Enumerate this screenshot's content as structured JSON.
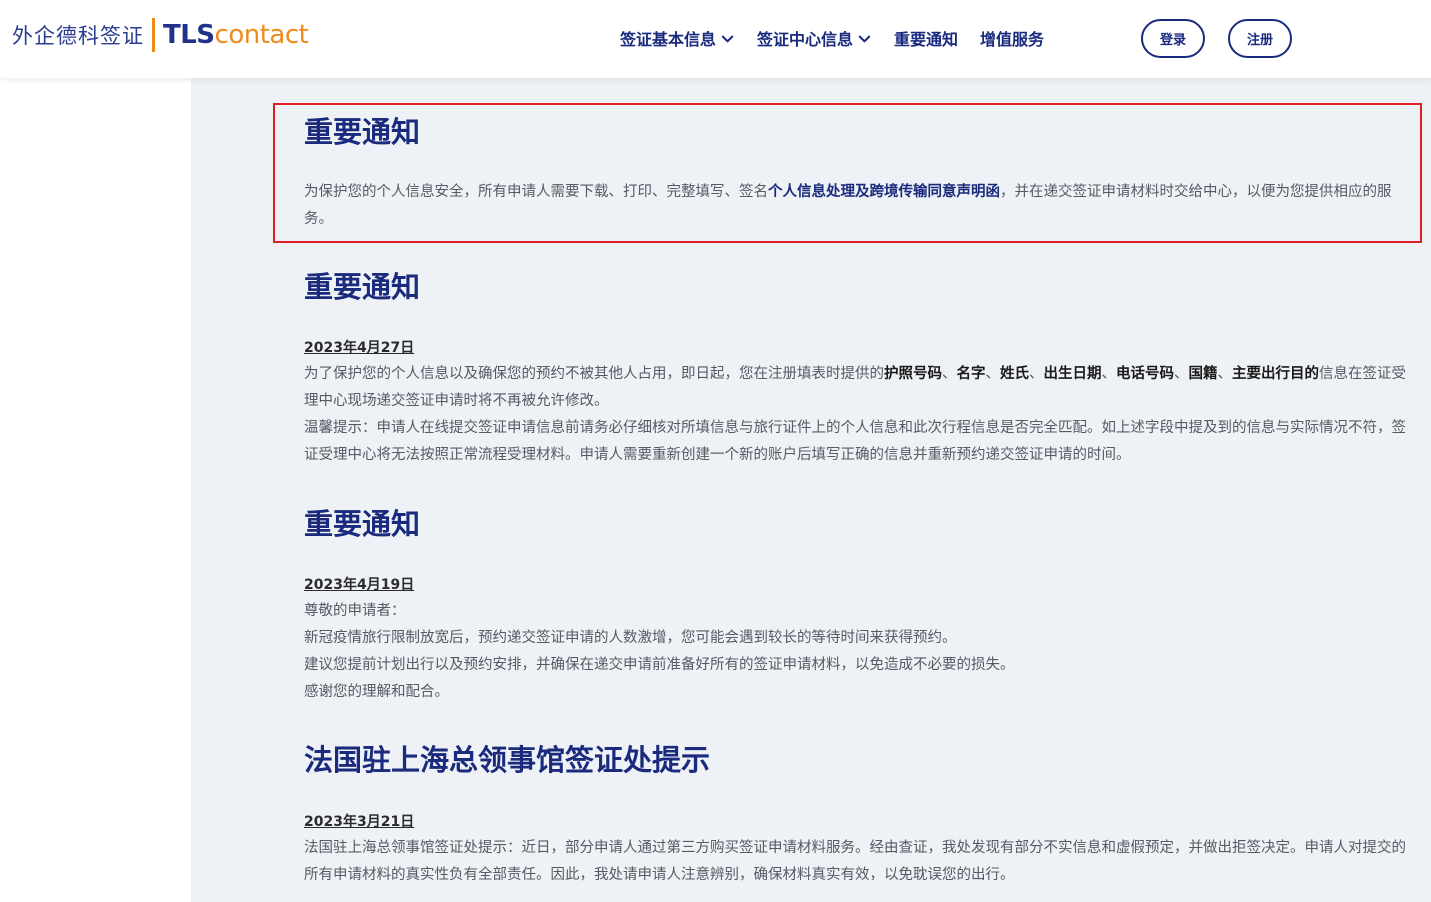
{
  "header": {
    "logo_cn": "外企德科签证",
    "logo_tls": "TLS",
    "logo_contact": "contact",
    "nav": [
      {
        "label": "签证基本信息",
        "has_dropdown": true
      },
      {
        "label": "签证中心信息",
        "has_dropdown": true
      },
      {
        "label": "重要通知",
        "has_dropdown": false
      },
      {
        "label": "增值服务",
        "has_dropdown": false
      }
    ],
    "login_label": "登录",
    "register_label": "注册"
  },
  "notices": [
    {
      "title": "重要通知",
      "p1_a": "为保护您的个人信息安全，所有申请人需要下载、打印、完整填写、签名",
      "p1_link": "个人信息处理及跨境传输同意声明函",
      "p1_b": "，并在递交签证申请材料时交给中心，以便为您提供相应的服务。"
    },
    {
      "title": "重要通知",
      "date": "2023年4月27日",
      "p1_a": "为了保护您的个人信息以及确保您的预约不被其他人占用，即日起，您在注册填表时提供的",
      "f1": "护照号码",
      "sep1": "、",
      "f2": "名字",
      "sep2": "、",
      "f3": "姓氏",
      "sep3": "、",
      "f4": "出生日期",
      "sep4": "、",
      "f5": "电话号码",
      "sep5": "、",
      "f6": "国籍",
      "sep6": "、",
      "f7": "主要出行目的",
      "p1_b": "信息在签证受理中心现场递交签证申请时将不再被允许修改。",
      "p2": "温馨提示：申请人在线提交签证申请信息前请务必仔细核对所填信息与旅行证件上的个人信息和此次行程信息是否完全匹配。如上述字段中提及到的信息与实际情况不符，签证受理中心将无法按照正常流程受理材料。申请人需要重新创建一个新的账户后填写正确的信息并重新预约递交签证申请的时间。"
    },
    {
      "title": "重要通知",
      "date": "2023年4月19日",
      "l1": "尊敬的申请者：",
      "l2": "新冠疫情旅行限制放宽后，预约递交签证申请的人数激增，您可能会遇到较长的等待时间来获得预约。",
      "l3": "建议您提前计划出行以及预约安排，并确保在递交申请前准备好所有的签证申请材料，以免造成不必要的损失。",
      "l4": "感谢您的理解和配合。"
    },
    {
      "title": "法国驻上海总领事馆签证处提示",
      "date": "2023年3月21日",
      "p1": "法国驻上海总领事馆签证处提示：近日，部分申请人通过第三方购买签证申请材料服务。经由查证，我处发现有部分不实信息和虚假预定，并做出拒签决定。申请人对提交的所有申请材料的真实性负有全部责任。因此，我处请申请人注意辨别，确保材料真实有效，以免耽误您的出行。"
    }
  ]
}
